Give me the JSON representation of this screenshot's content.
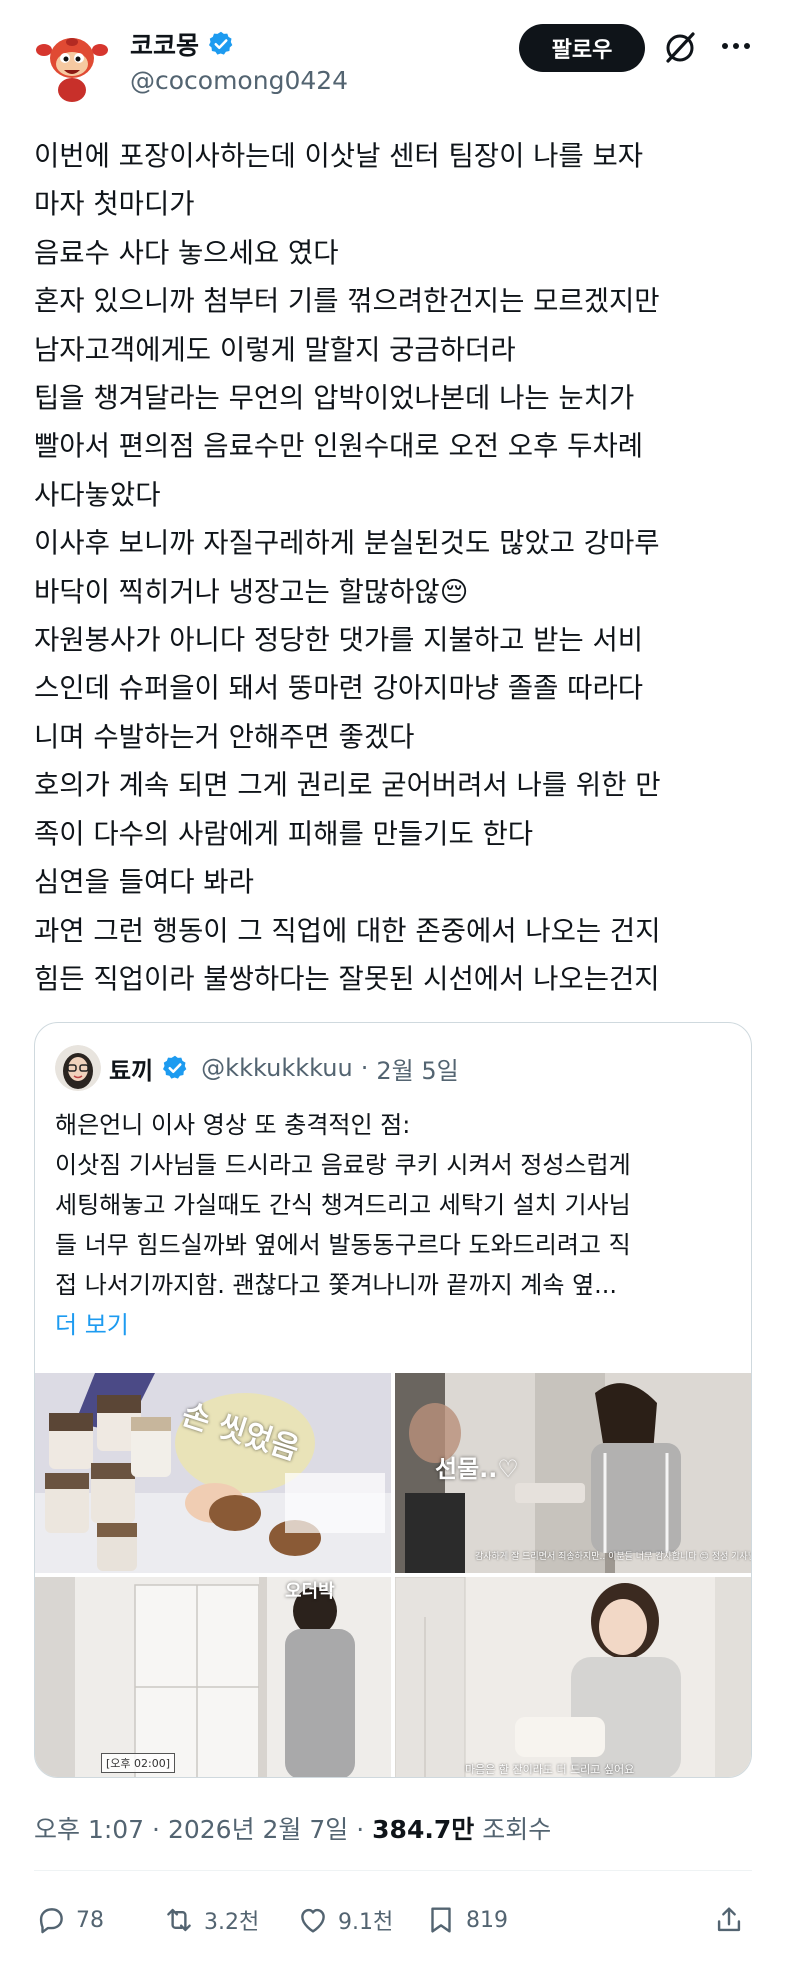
{
  "author": {
    "display_name": "코코몽",
    "handle": "@cocomong0424",
    "verified": true
  },
  "header": {
    "follow_label": "팔로우",
    "icons": [
      "grok-icon",
      "more-icon"
    ]
  },
  "tweet": {
    "lines": [
      "이번에 포장이사하는데 이삿날 센터 팀장이 나를 보자",
      "마자 첫마디가",
      "음료수 사다 놓으세요 였다",
      "혼자 있으니까 첨부터 기를 꺾으려한건지는 모르겠지만",
      "남자고객에게도 이렇게 말할지 궁금하더라",
      "팁을 챙겨달라는 무언의 압박이었나본데 나는 눈치가",
      "빨아서 편의점 음료수만 인원수대로 오전 오후 두차례",
      "사다놓았다",
      "이사후 보니까 자질구레하게 분실된것도 많았고 강마루",
      "바닥이 찍히거나 냉장고는 할많하않😔",
      "자원봉사가 아니다 정당한 댓가를 지불하고 받는 서비",
      "스인데 슈퍼을이 돼서 뚱마련 강아지마냥 졸졸 따라다",
      "니며 수발하는거 안해주면 좋겠다",
      "호의가 계속 되면 그게 권리로 굳어버려서 나를 위한 만",
      "족이 다수의 사람에게 피해를 만들기도 한다",
      "심연을 들여다 봐라",
      "과연 그런 행동이 그 직업에 대한 존중에서 나오는 건지",
      "힘든 직업이라 불쌍하다는 잘못된 시선에서 나오는건지"
    ]
  },
  "quote": {
    "display_name": "툐끼",
    "handle": "@kkkukkkuu",
    "separator": "·",
    "date": "2월 5일",
    "verified": true,
    "lines": [
      "해은언니 이사 영상 또 충격적인 점:",
      "이삿짐 기사님들 드시라고 음료랑 쿠키 시켜서 정성스럽게",
      "세팅해놓고 가실때도 간식 챙겨드리고 세탁기 설치 기사님",
      "들 너무 힘드실까봐 옆에서 발동동구르다 도와드리려고 직",
      "접 나서기까지함. 괜찮다고 쫓겨나니까 끝까지 계속 옆..."
    ],
    "show_more": "더 보기",
    "media": [
      {
        "caption": "손 씻었음",
        "sub": ""
      },
      {
        "caption": "선물..♡",
        "sub": "감사하게 잘 드리면서 죄송하지만.. 이분들 너무 감사합니다 😊 정성 기사님들 너무 친절하시고 TT"
      },
      {
        "caption": "오더박",
        "time": "[오후 02:00]"
      },
      {
        "caption": "",
        "sub": "마음은 한 잔이라도 더 드리고 싶어요"
      }
    ]
  },
  "meta": {
    "time": "오후 1:07",
    "sep1": "·",
    "date": "2026년 2월 7일",
    "sep2": "·",
    "views_count": "384.7만",
    "views_label": "조회수"
  },
  "actions": {
    "replies": "78",
    "reposts": "3.2천",
    "likes": "9.1천",
    "bookmarks": "819"
  },
  "colors": {
    "text": "#0f1419",
    "secondary": "#536471",
    "link": "#1d9bf0",
    "verified": "#1d9bf0",
    "border": "#cfd9de"
  }
}
